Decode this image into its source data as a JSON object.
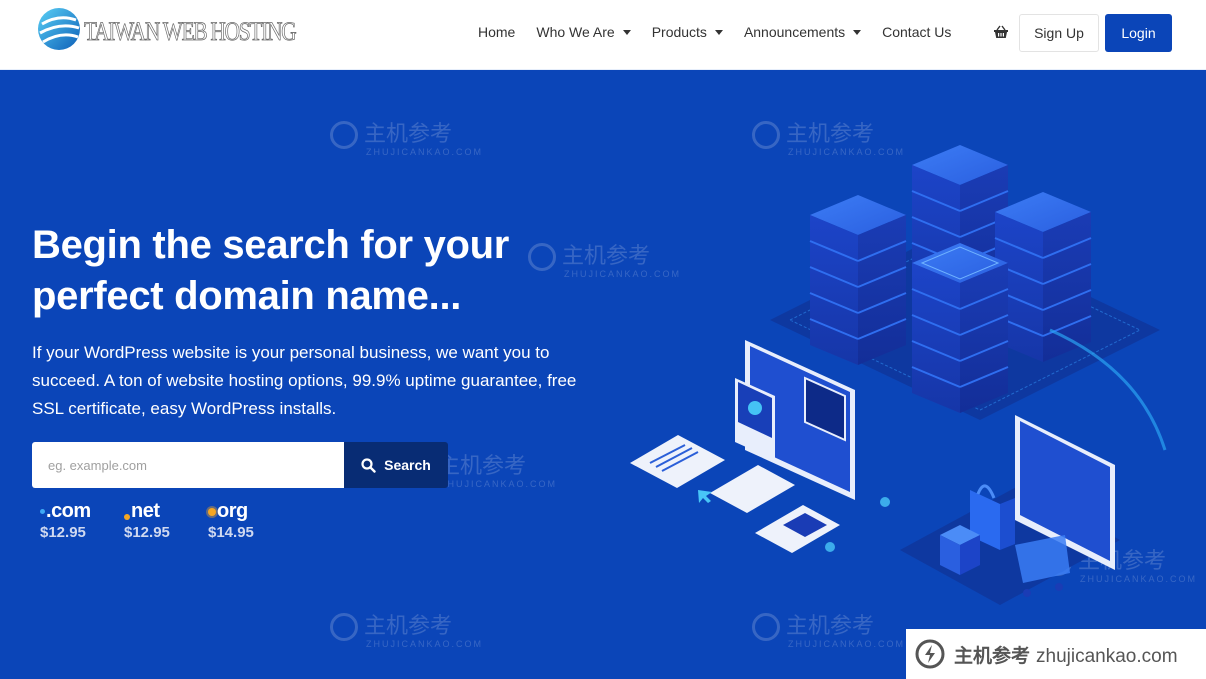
{
  "brand": {
    "name": "TAIWAN WEB HOSTING",
    "accent": "#0b45b8",
    "dark_accent": "#082c74"
  },
  "nav": {
    "items": [
      {
        "label": "Home",
        "dropdown": false
      },
      {
        "label": "Who We Are",
        "dropdown": true
      },
      {
        "label": "Products",
        "dropdown": true
      },
      {
        "label": "Announcements",
        "dropdown": true
      },
      {
        "label": "Contact Us",
        "dropdown": false
      }
    ],
    "cart_icon": "shopping-basket-icon",
    "signup_label": "Sign Up",
    "login_label": "Login"
  },
  "hero": {
    "title": "Begin the search for your perfect domain name...",
    "subtitle": "If your WordPress website is your personal business, we want you to succeed. A ton of website hosting options, 99.9% uptime guarantee, free SSL certificate, easy WordPress installs.",
    "search": {
      "placeholder": "eg. example.com",
      "value": "",
      "button_label": "Search",
      "icon": "search-icon"
    },
    "tlds": [
      {
        "name": "com",
        "price": "$12.95",
        "dot_color": "#3fa9f5"
      },
      {
        "name": "net",
        "price": "$12.95",
        "dot_color": "#f5a623"
      },
      {
        "name": "org",
        "price": "$14.95",
        "dot_color": "#f5a623"
      }
    ]
  },
  "watermark": {
    "cn": "主机参考",
    "en": "ZHUJICANKAO.COM",
    "badge_cn": "主机参考",
    "badge_en": "zhujicankao.com"
  }
}
